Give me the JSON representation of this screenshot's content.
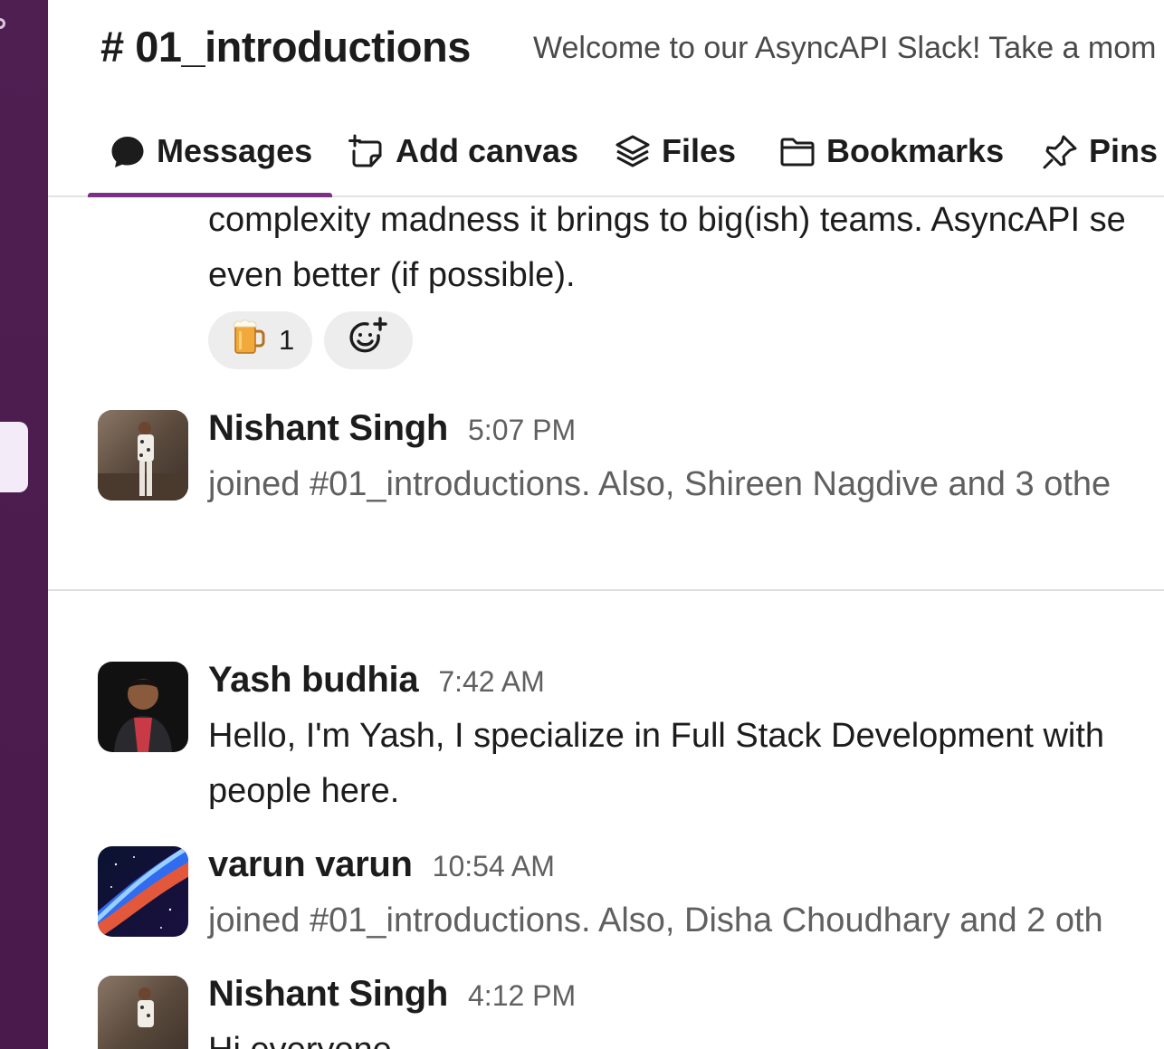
{
  "channel": {
    "name": "# 01_introductions",
    "topic": "Welcome to our AsyncAPI Slack! Take a mom"
  },
  "tabs": [
    {
      "label": "Messages",
      "icon": "message-bubble-icon",
      "active": true
    },
    {
      "label": "Add canvas",
      "icon": "canvas-icon",
      "active": false
    },
    {
      "label": "Files",
      "icon": "files-stack-icon",
      "active": false
    },
    {
      "label": "Bookmarks",
      "icon": "folder-icon",
      "active": false
    },
    {
      "label": "Pins",
      "icon": "pin-icon",
      "active": false
    }
  ],
  "messages": {
    "partial": {
      "line1": "complexity madness it brings to big(ish) teams. AsyncAPI se",
      "line2": "even better (if possible).",
      "reaction_emoji": "🍺",
      "reaction_count": "1",
      "add_reaction_icon": "add-emoji-icon"
    },
    "m1": {
      "author": "Nishant Singh",
      "time": "5:07 PM",
      "text": "joined #01_introductions. Also, Shireen Nagdive and 3 othe"
    },
    "m2": {
      "author": "Yash budhia",
      "time": "7:42 AM",
      "line1": "Hello, I'm Yash, I specialize in Full Stack Development with",
      "line2": "people here."
    },
    "m3": {
      "author": "varun varun",
      "time": "10:54 AM",
      "text": "joined #01_introductions. Also, Disha Choudhary and 2 oth"
    },
    "m4": {
      "author": "Nishant Singh",
      "time": "4:12 PM",
      "text": "Hi everyone"
    }
  },
  "colors": {
    "sidebar": "#4a154b",
    "active_tab_underline": "#7c3085",
    "reaction_bg": "#ededed"
  }
}
